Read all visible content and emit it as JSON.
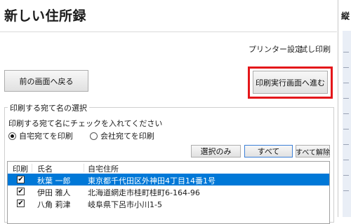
{
  "window": {
    "title": "新しい住所録"
  },
  "toolbar": {
    "printer_settings": "プリンター設定",
    "test_print": "試し印刷"
  },
  "buttons": {
    "back": "前の画面へ戻る",
    "next": "印刷実行画面へ進む"
  },
  "selection_group": {
    "legend": "印刷する宛て名の選択",
    "hint": "印刷する宛て名にチェックを入れてください",
    "radio_home": "自宅宛てを印刷",
    "radio_company": "会社宛てを印刷",
    "selected_radio": "自宅宛てを印刷",
    "select_only": "選択のみ",
    "select_all": "すべて",
    "clear_all": "すべて解除"
  },
  "list": {
    "headers": {
      "print": "印刷",
      "name": "氏名",
      "address": "自宅住所"
    },
    "rows": [
      {
        "checked": true,
        "name": "秋葉 一郎",
        "address": "東京都千代田区外神田4丁目14番1号",
        "selected": true
      },
      {
        "checked": true,
        "name": "伊田 雅人",
        "address": "北海道網走市桂町桂町6-164-96",
        "selected": false
      },
      {
        "checked": true,
        "name": "八角 莉津",
        "address": "岐阜県下呂市小川1-5",
        "selected": false
      }
    ],
    "check_glyph": "✔"
  },
  "right_panel": {
    "title": "縦"
  },
  "colors": {
    "highlight": "#e4161a",
    "selection": "#0078d7"
  }
}
